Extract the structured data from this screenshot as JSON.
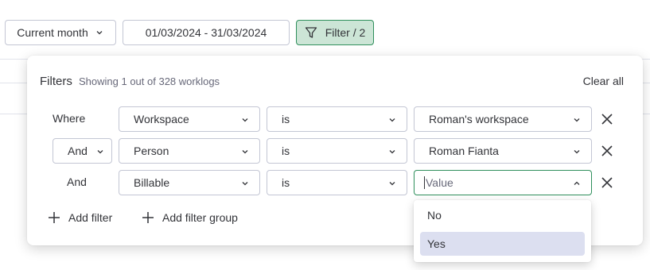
{
  "toolbar": {
    "month_label": "Current month",
    "date_range": "01/03/2024 - 31/03/2024",
    "filter_label": "Filter / 2"
  },
  "panel": {
    "title": "Filters",
    "subtitle": "Showing 1 out of 328 worklogs",
    "clear_all": "Clear all"
  },
  "rows": [
    {
      "conj": "Where",
      "field": "Workspace",
      "operator": "is",
      "value": "Roman's workspace"
    },
    {
      "conj": "And",
      "field": "Person",
      "operator": "is",
      "value": "Roman Fianta"
    },
    {
      "conj": "And",
      "field": "Billable",
      "operator": "is",
      "value": "",
      "placeholder": "Value"
    }
  ],
  "actions": {
    "add_filter": "Add filter",
    "add_filter_group": "Add filter group"
  },
  "dropdown": {
    "options": [
      "No",
      "Yes"
    ],
    "highlighted": "Yes"
  },
  "colors": {
    "accent_green": "#2f8f5c",
    "filter_bg": "#cce5d6",
    "highlight": "#dcdff0",
    "text": "#323338",
    "muted": "#676879"
  },
  "icons": {
    "filter": "filter-funnel-icon",
    "chevron": "chevron-down-icon",
    "chevron_up": "chevron-up-icon",
    "close": "close-icon",
    "plus": "plus-icon"
  }
}
